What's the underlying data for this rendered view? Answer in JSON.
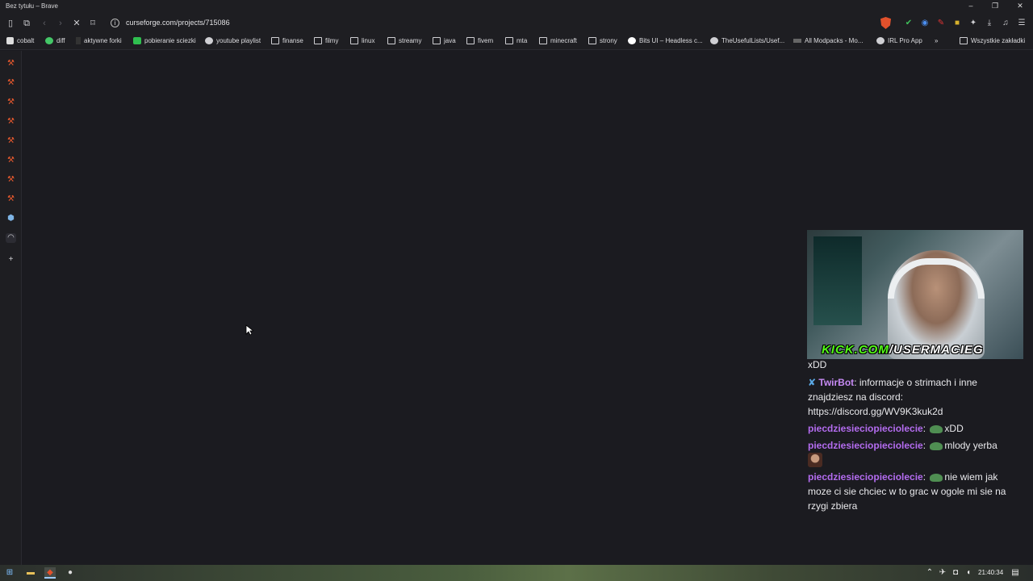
{
  "window": {
    "title": "Bez tytułu – Brave"
  },
  "toolbar": {
    "url": "curseforge.com/projects/715086"
  },
  "bookmarks": [
    {
      "label": "cobalt",
      "icon": "cobalt-icon"
    },
    {
      "label": "diff",
      "icon": "diff-icon"
    },
    {
      "label": "aktywne forki",
      "icon": "fork-icon"
    },
    {
      "label": "pobieranie sciezki",
      "icon": "download-icon"
    },
    {
      "label": "youtube playlist",
      "icon": "globe-icon"
    },
    {
      "label": "finanse",
      "icon": "folder-icon"
    },
    {
      "label": "filmy",
      "icon": "folder-icon"
    },
    {
      "label": "linux",
      "icon": "folder-icon"
    },
    {
      "label": "streamy",
      "icon": "folder-icon"
    },
    {
      "label": "java",
      "icon": "folder-icon"
    },
    {
      "label": "fivem",
      "icon": "folder-icon"
    },
    {
      "label": "mta",
      "icon": "folder-icon"
    },
    {
      "label": "minecraft",
      "icon": "folder-icon"
    },
    {
      "label": "strony",
      "icon": "folder-icon"
    },
    {
      "label": "Bits UI – Headless c...",
      "icon": "bits-icon"
    },
    {
      "label": "TheUsefulLists/Usef...",
      "icon": "github-icon"
    },
    {
      "label": "All Modpacks - Mo...",
      "icon": "modpacks-icon"
    },
    {
      "label": "IRL Pro App",
      "icon": "globe-icon"
    }
  ],
  "bookmarks_overflow": "»",
  "bookmarks_all": "Wszystkie zakładki",
  "stream": {
    "overlay_left": "KICK.COM",
    "overlay_sep": "/",
    "overlay_right": "USERMACIEG"
  },
  "chat": {
    "top_fragment": "xDD",
    "messages": [
      {
        "user": "TwirBot",
        "text": "informacje o strimach i inne znajdziesz na discord: https://discord.gg/WV9K3kuk2d"
      },
      {
        "user": "piecdziesieciopieciolecie",
        "text": "xDD"
      },
      {
        "user": "piecdziesieciopieciolecie",
        "text": "mlody yerba"
      },
      {
        "user": "piecdziesieciopieciolecie",
        "text": "nie wiem jak moze ci sie chciec w to grac w ogole mi sie na rzygi zbiera"
      }
    ]
  },
  "taskbar": {
    "time": "21:40:34"
  },
  "colors": {
    "brave": "#e2512c",
    "chat_user": "#b46cf0",
    "kick_green": "#53fc18"
  }
}
